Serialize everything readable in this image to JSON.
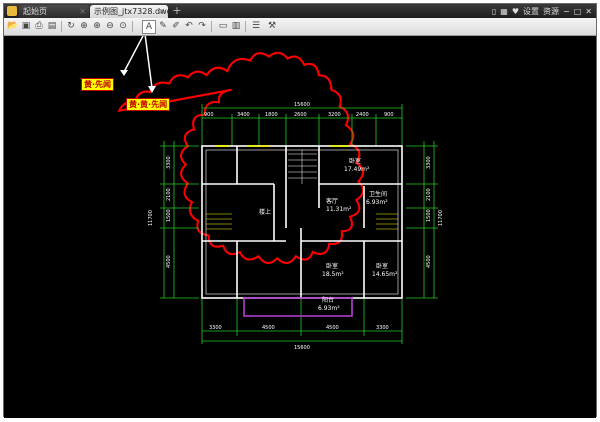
{
  "tabs": {
    "start_label": "起始页",
    "doc_label": "示例图_jtx7328.dwg",
    "add_label": "+"
  },
  "window_controls": {
    "settings_label": "设置",
    "resources_label": "资源"
  },
  "annotations": {
    "callout_1": "黄·先闻",
    "callout_2": "黄·黄·先闻"
  },
  "drawing": {
    "top_total": "15600",
    "top_dims": [
      "900",
      "3400",
      "1800",
      "2600",
      "3200",
      "2400",
      "900"
    ],
    "bottom_dims": [
      "3300",
      "4500",
      "4500",
      "3300"
    ],
    "bottom_total": "15600",
    "left_dims": [
      "3300",
      "2100",
      "1500",
      "4500"
    ],
    "left_total": "11700",
    "right_dims": [
      "3300",
      "2100",
      "1500",
      "4500"
    ],
    "right_total": "11700",
    "rooms": [
      {
        "name": "卧室",
        "area": "17.49m²"
      },
      {
        "name": "楼上",
        "area": ""
      },
      {
        "name": "客厅",
        "area": "11.31m²"
      },
      {
        "name": "卫生间",
        "area": "6.93m²"
      },
      {
        "name": "卧室",
        "area": "18.5m²"
      },
      {
        "name": "卧室",
        "area": "14.65m²"
      },
      {
        "name": "阳台",
        "area": "6.93m²"
      }
    ]
  },
  "colors": {
    "revision_cloud": "#ff0000",
    "callout_bg": "#ffff00",
    "dimension_lines": "#22cc22",
    "walls": "#ffffff",
    "balcony": "#b03fd0"
  }
}
